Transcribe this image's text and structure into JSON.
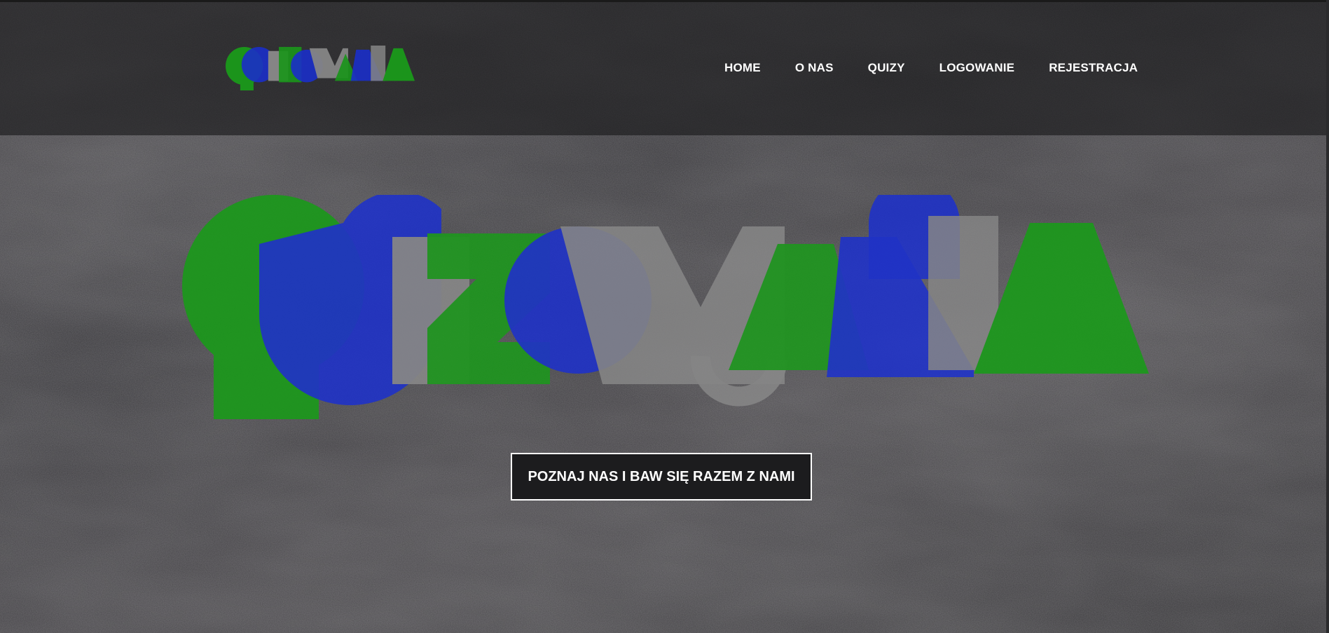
{
  "site": {
    "logo_text": "QUIZOMANIA"
  },
  "nav": {
    "items": [
      {
        "label": "HOME"
      },
      {
        "label": "O NAS"
      },
      {
        "label": "QUIZY"
      },
      {
        "label": "LOGOWANIE"
      },
      {
        "label": "REJESTRACJA"
      }
    ]
  },
  "hero": {
    "cta_label": "POZNAJ NAS I BAW SIĘ RAZEM Z NAMI"
  },
  "colors": {
    "logo_green": "#1a9a1a",
    "logo_blue": "#1a2fd0",
    "logo_gray": "#8a8a8a",
    "header_bg": "#1e1e20",
    "button_bg": "#1c1c1e",
    "text": "#ffffff"
  }
}
